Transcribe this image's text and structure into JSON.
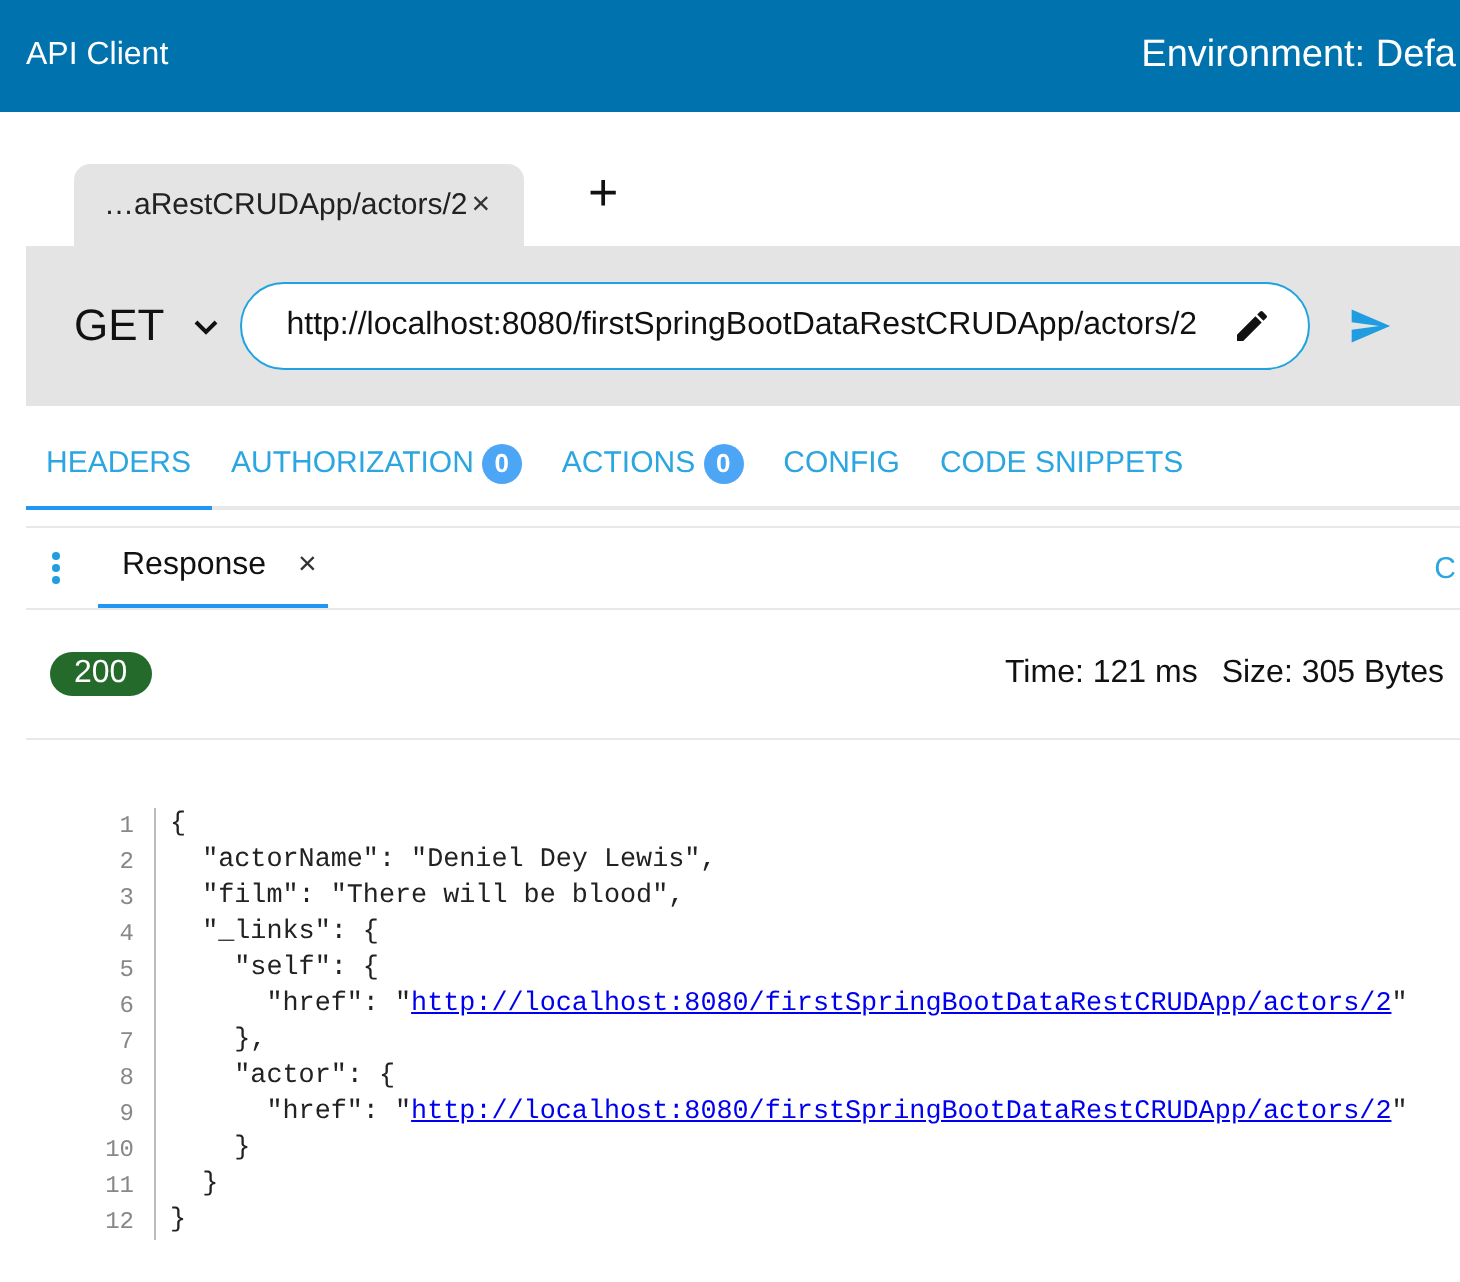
{
  "header": {
    "title": "API Client",
    "environment": "Environment: Defa"
  },
  "request_tabs": [
    {
      "label": "…aRestCRUDApp/actors/2",
      "close": "×",
      "selected": true
    }
  ],
  "new_tab": "+",
  "request": {
    "method": "GET",
    "url": "http://localhost:8080/firstSpringBootDataRestCRUDApp/actors/2"
  },
  "section_tabs": [
    {
      "label": "HEADERS",
      "selected": true
    },
    {
      "label": "AUTHORIZATION",
      "badge": "0",
      "selected": false
    },
    {
      "label": "ACTIONS",
      "badge": "0",
      "selected": false
    },
    {
      "label": "CONFIG",
      "selected": false
    },
    {
      "label": "CODE SNIPPETS",
      "selected": false
    }
  ],
  "response_tabs": [
    {
      "label": "Response",
      "close": "×",
      "selected": true
    }
  ],
  "response_right": "C",
  "status": {
    "code": "200",
    "time": "Time: 121 ms",
    "size": "Size: 305 Bytes"
  },
  "code_lines": [
    {
      "number": "1",
      "text": "{"
    },
    {
      "number": "2",
      "text": "  \"actorName\": \"Deniel Dey Lewis\","
    },
    {
      "number": "3",
      "text": "  \"film\": \"There will be blood\","
    },
    {
      "number": "4",
      "text": "  \"_links\": {"
    },
    {
      "number": "5",
      "text": "    \"self\": {"
    },
    {
      "number": "6",
      "text": "      \"href\": \"",
      "link": "http://localhost:8080/firstSpringBootDataRestCRUDApp/actors/2",
      "after": "\""
    },
    {
      "number": "7",
      "text": "    },"
    },
    {
      "number": "8",
      "text": "    \"actor\": {"
    },
    {
      "number": "9",
      "text": "      \"href\": \"",
      "link": "http://localhost:8080/firstSpringBootDataRestCRUDApp/actors/2",
      "after": "\""
    },
    {
      "number": "10",
      "text": "    }"
    },
    {
      "number": "11",
      "text": "  }"
    },
    {
      "number": "12",
      "text": "}"
    }
  ]
}
